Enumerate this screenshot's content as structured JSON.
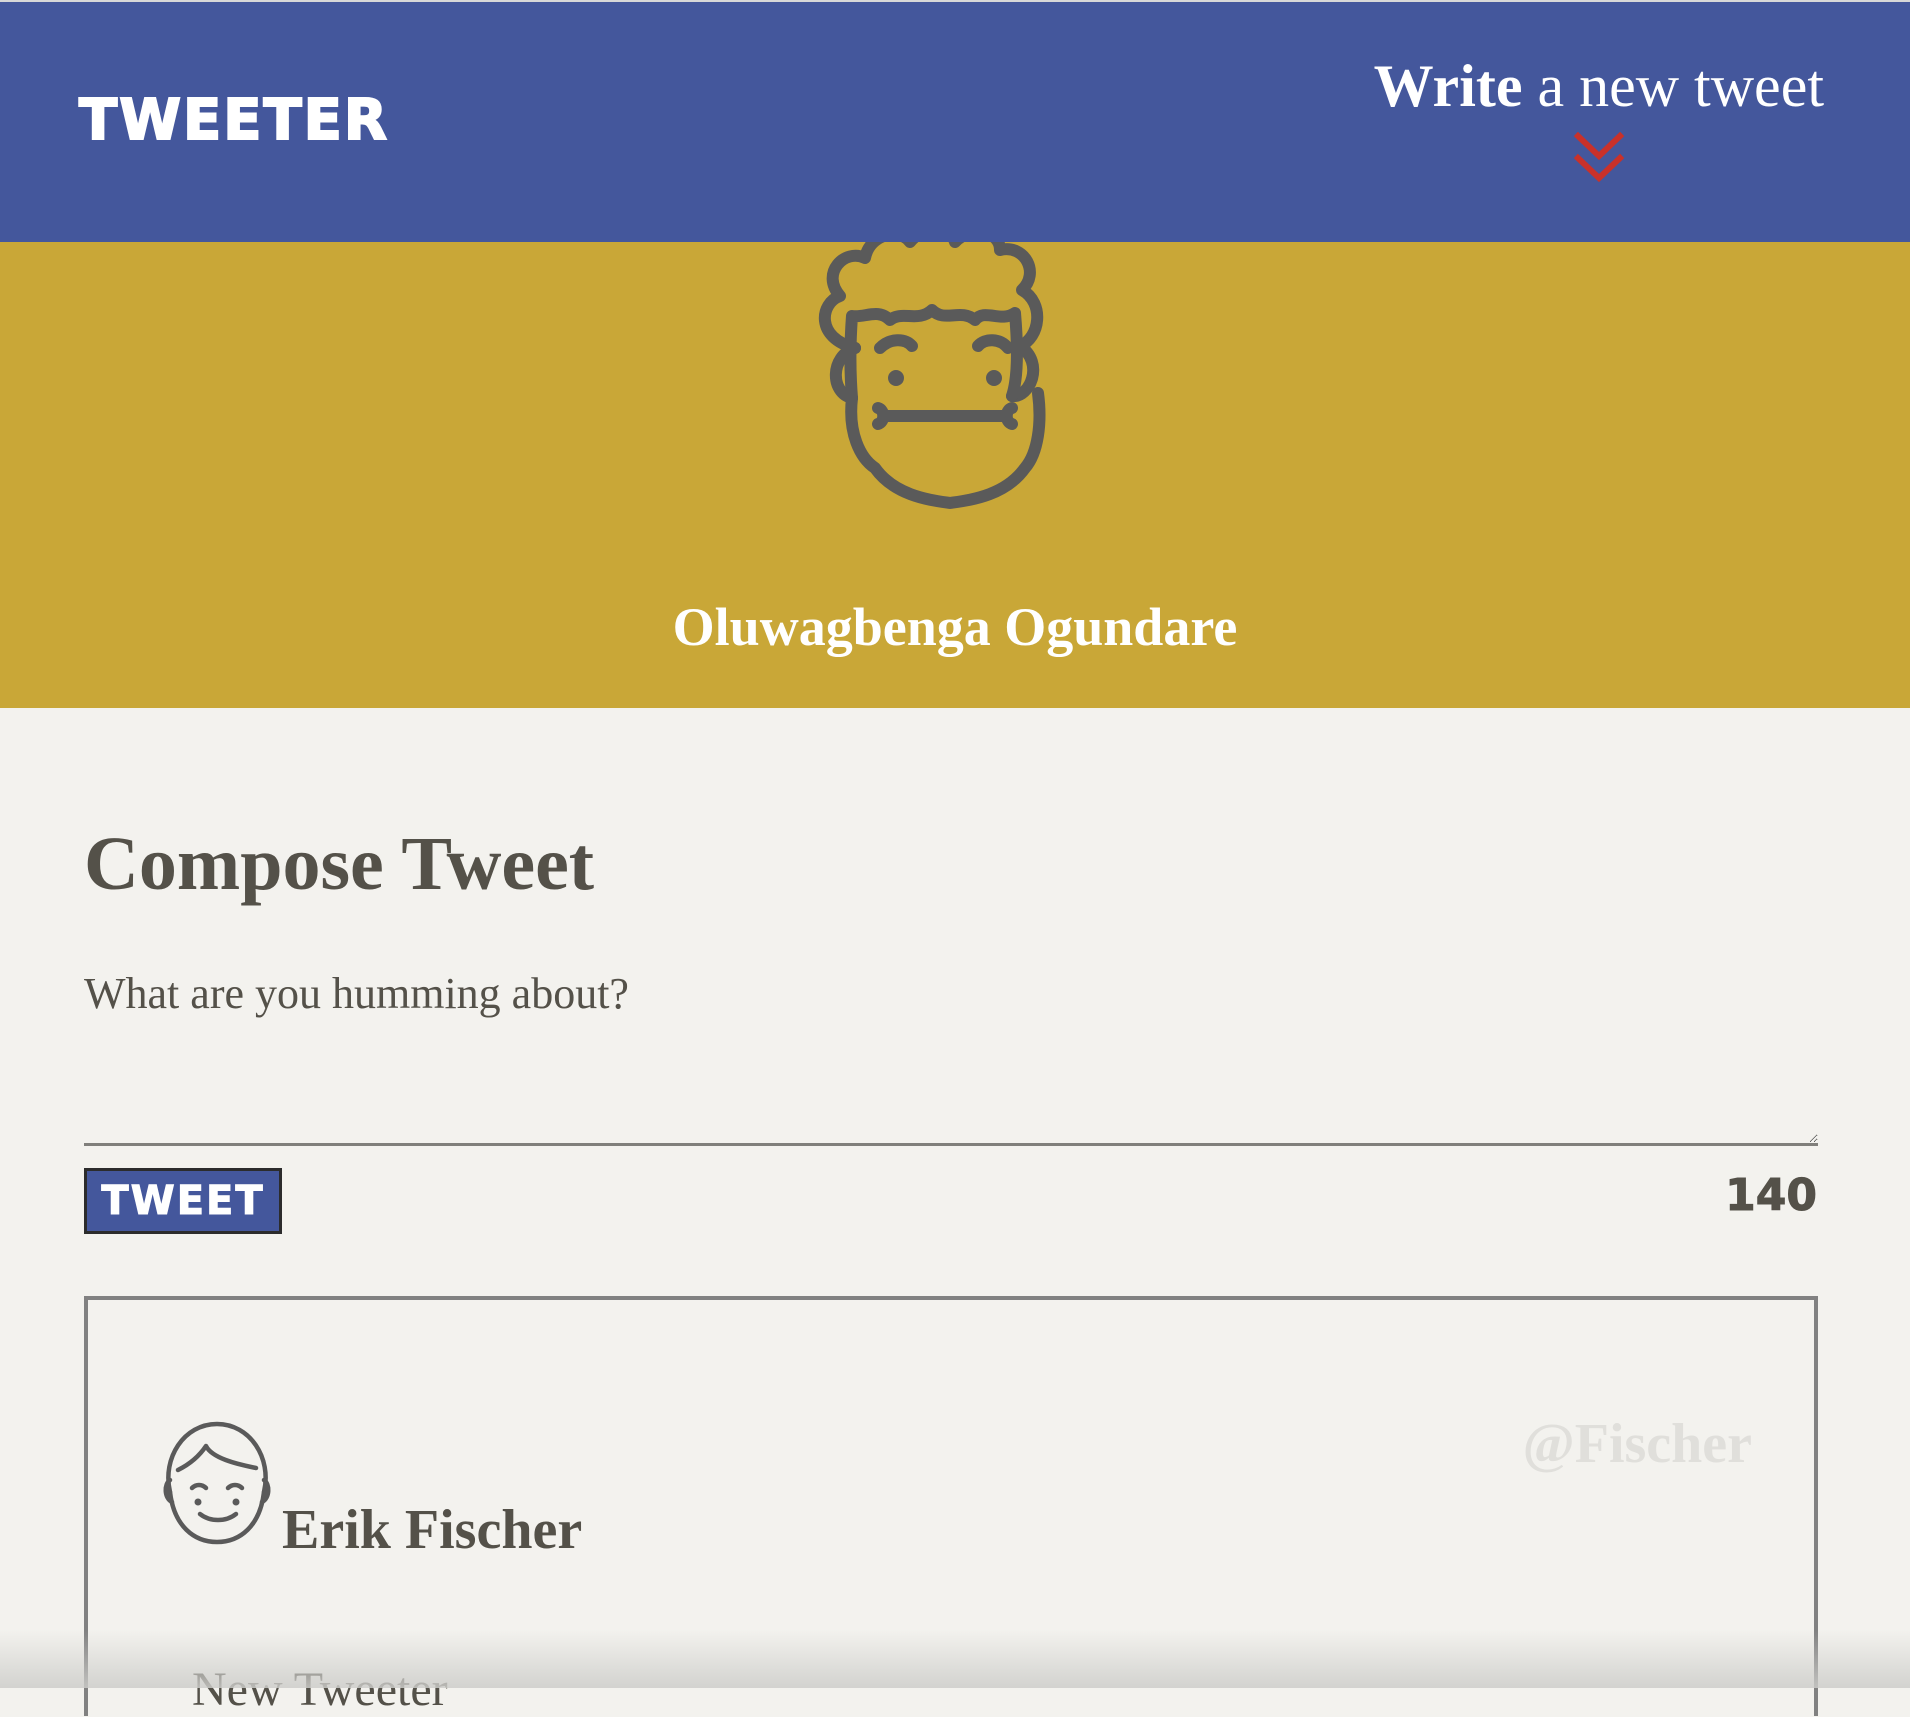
{
  "header": {
    "brand": "TWEETER",
    "write_bold": "Write",
    "write_rest": " a new tweet",
    "chevron_icon": "double-chevron-down-icon",
    "accent_color": "#c9312a",
    "bar_color": "#44579c"
  },
  "profile": {
    "name": "Oluwagbenga Ogundare",
    "banner_color": "#c9a737",
    "avatar_icon": "curly-hair-face-avatar"
  },
  "compose": {
    "title": "Compose Tweet",
    "placeholder": "What are you humming about?",
    "value": "",
    "button_label": "TWEET",
    "char_counter": "140"
  },
  "tweets": [
    {
      "name": "Erik Fischer",
      "handle": "@Fischer",
      "content": "New Tweeter",
      "avatar_icon": "smiling-face-avatar"
    }
  ]
}
